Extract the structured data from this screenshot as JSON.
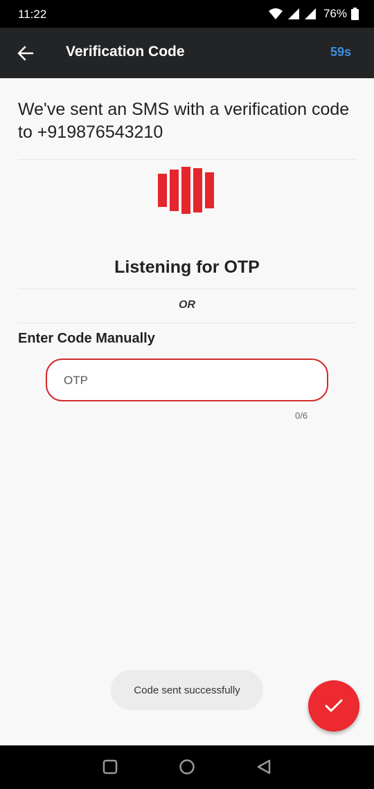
{
  "status_bar": {
    "time": "11:22",
    "battery": "76%"
  },
  "app_bar": {
    "title": "Verification Code",
    "timer": "59s"
  },
  "message": "We've sent an SMS with a verification code to +919876543210",
  "listening_text": "Listening for OTP",
  "or_text": "OR",
  "manual_label": "Enter Code Manually",
  "otp": {
    "placeholder": "OTP",
    "value": "",
    "counter": "0/6"
  },
  "toast": "Code sent successfully",
  "colors": {
    "accent": "#ec2a2f",
    "timer": "#3b8fe4",
    "app_bar": "#222426"
  },
  "icons": [
    "back-arrow-icon",
    "wifi-icon",
    "signal-icon",
    "battery-icon",
    "logo-bars",
    "check-icon",
    "square-nav-icon",
    "circle-nav-icon",
    "triangle-nav-icon"
  ]
}
